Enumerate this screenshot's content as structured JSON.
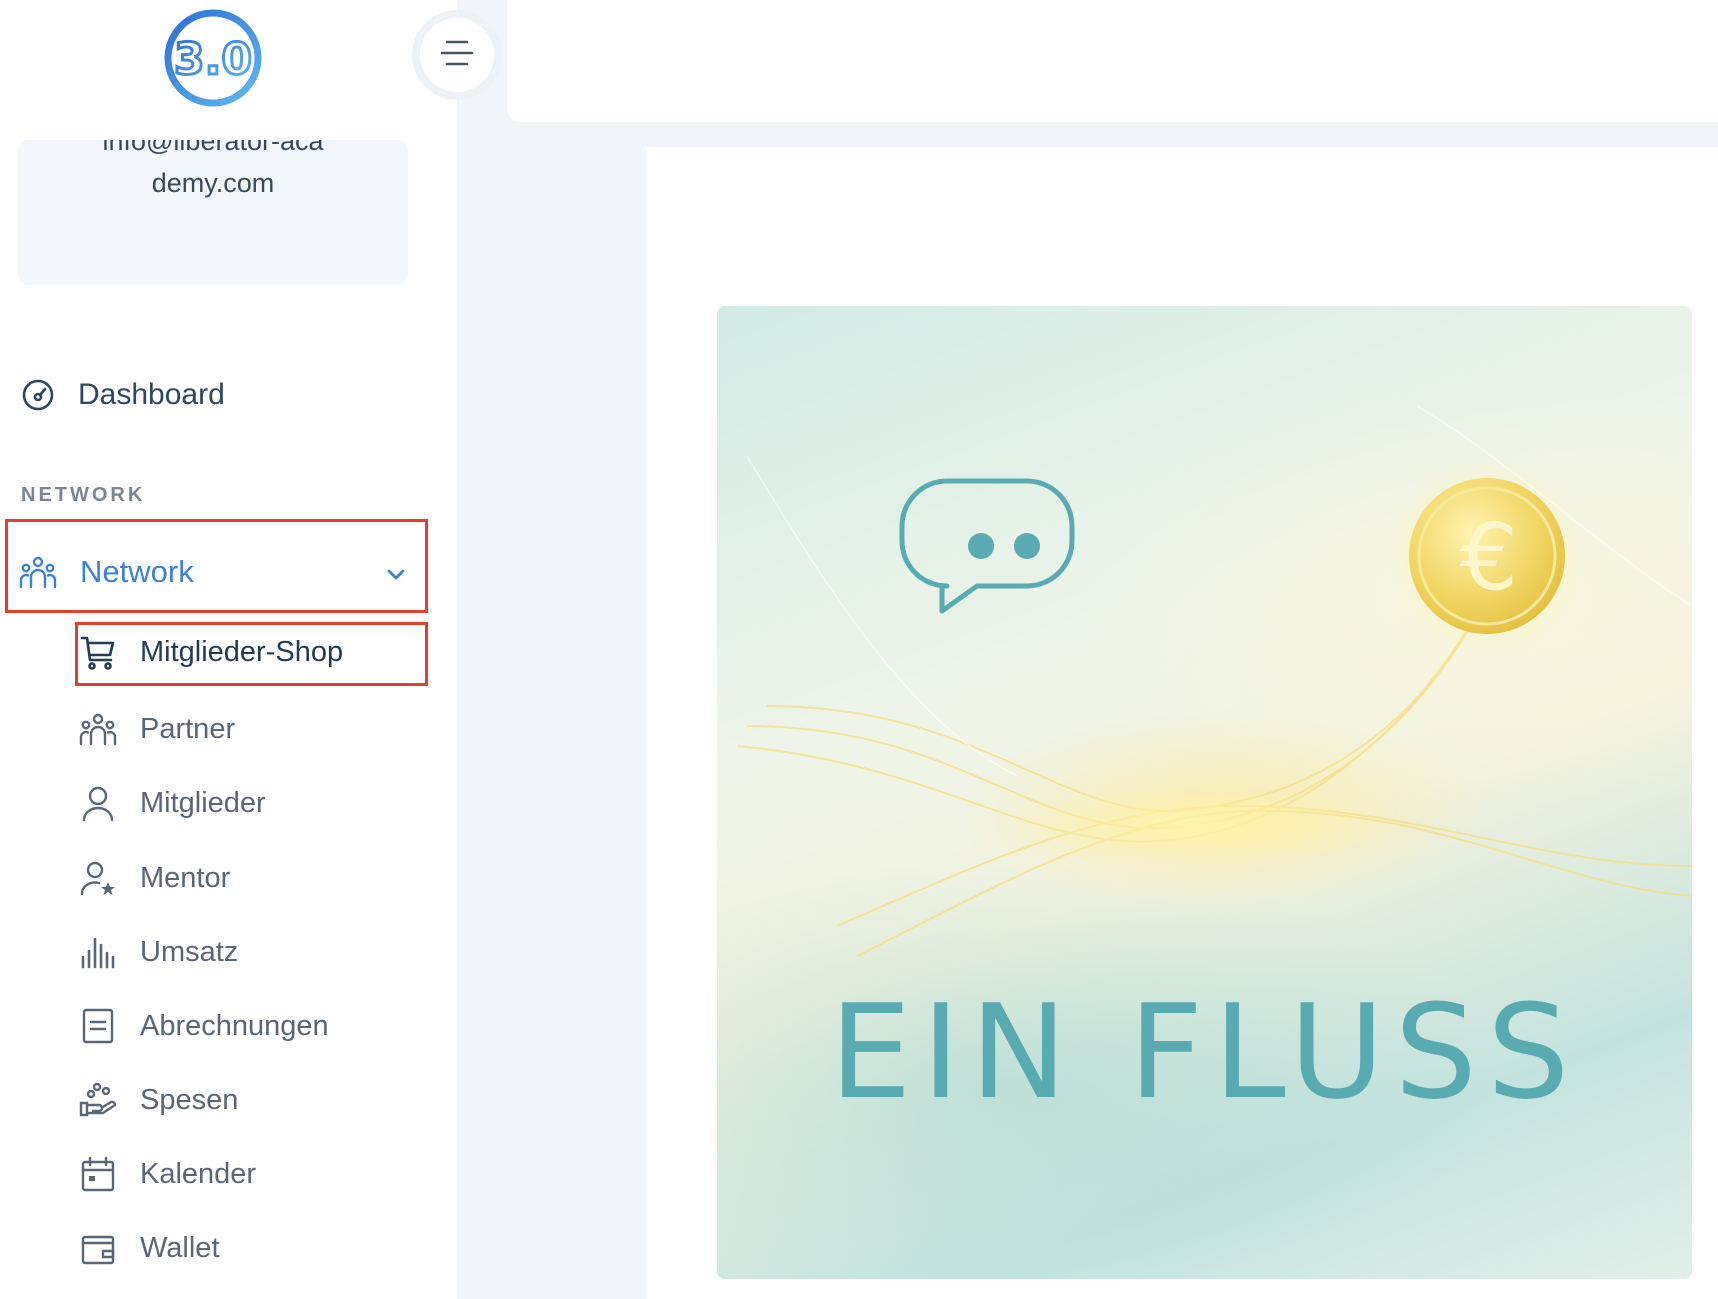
{
  "logo": {
    "text": "3.0",
    "color": "#3f8fe0"
  },
  "user": {
    "email": "info@liberator-academy.com"
  },
  "menu_toggle": {
    "icon": "hamburger-icon"
  },
  "nav": {
    "dashboard": {
      "label": "Dashboard",
      "icon": "speedometer-icon"
    },
    "section_title": "NETWORK",
    "network": {
      "label": "Network",
      "icon": "users-icon",
      "expanded": true
    },
    "items": [
      {
        "label": "Mitglieder-Shop",
        "icon": "cart-icon",
        "active": true
      },
      {
        "label": "Partner",
        "icon": "users-icon"
      },
      {
        "label": "Mitglieder",
        "icon": "user-icon"
      },
      {
        "label": "Mentor",
        "icon": "user-star-icon"
      },
      {
        "label": "Umsatz",
        "icon": "bar-chart-icon"
      },
      {
        "label": "Abrechnungen",
        "icon": "document-icon"
      },
      {
        "label": "Spesen",
        "icon": "hand-coins-icon"
      },
      {
        "label": "Kalender",
        "icon": "calendar-icon"
      },
      {
        "label": "Wallet",
        "icon": "wallet-icon"
      }
    ]
  },
  "banner": {
    "text": "EIN FLUSS",
    "text_color": "#5aaab1",
    "coin_symbol": "€"
  },
  "colors": {
    "accent": "#3b82d6",
    "highlight": "#e0412c"
  }
}
